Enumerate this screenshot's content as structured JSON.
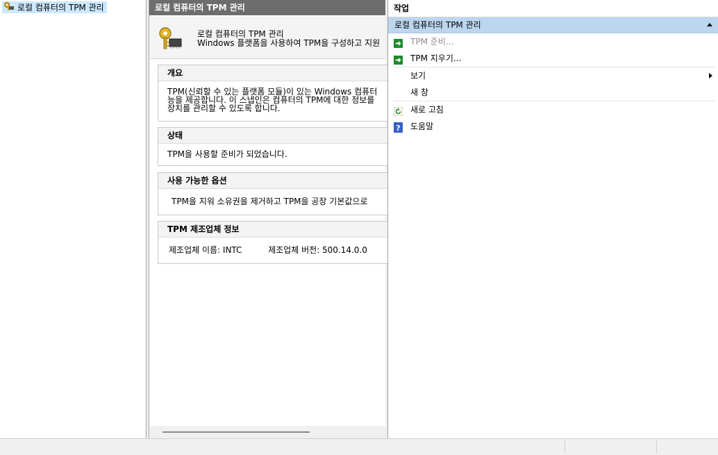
{
  "tree": {
    "root_label": "로컬 컴퓨터의 TPM 관리"
  },
  "center": {
    "header": "로컬 컴퓨터의 TPM 관리",
    "intro_title": "로컬 컴퓨터의 TPM 관리",
    "intro_subtitle": "Windows 플랫폼을 사용하여 TPM을 구성하고 지원",
    "sections": [
      {
        "title": "개요",
        "lines": [
          "TPM(신뢰할 수 있는 플랫폼 모듈)이 있는 Windows 컴퓨터",
          "능을 제공합니다. 이 스냅인은 컴퓨터의 TPM에 대한 정보를",
          "장치를 관리할 수 있도록 합니다."
        ]
      },
      {
        "title": "상태",
        "lines": [
          "TPM을 사용할 준비가 되었습니다."
        ]
      },
      {
        "title": "사용 가능한 옵션",
        "lines": [
          "TPM을 지워 소유권을 제거하고 TPM을 공장 기본값으로"
        ]
      },
      {
        "title": "TPM 제조업체 정보",
        "manufacturer_name": "제조업체 이름: INTC",
        "manufacturer_version": "제조업체 버전: 500.14.0.0"
      }
    ]
  },
  "actions": {
    "title": "작업",
    "group_label": "로컬 컴퓨터의 TPM 관리",
    "items": [
      {
        "label": "TPM 준비...",
        "icon": "green-arrow-icon",
        "disabled": true
      },
      {
        "label": "TPM 지우기...",
        "icon": "green-arrow-icon",
        "disabled": false
      },
      {
        "label": "보기",
        "icon": "",
        "submenu": true
      },
      {
        "label": "새 창",
        "icon": ""
      },
      {
        "label": "새로 고침",
        "icon": "refresh-icon"
      },
      {
        "label": "도움말",
        "icon": "help-icon"
      }
    ]
  }
}
